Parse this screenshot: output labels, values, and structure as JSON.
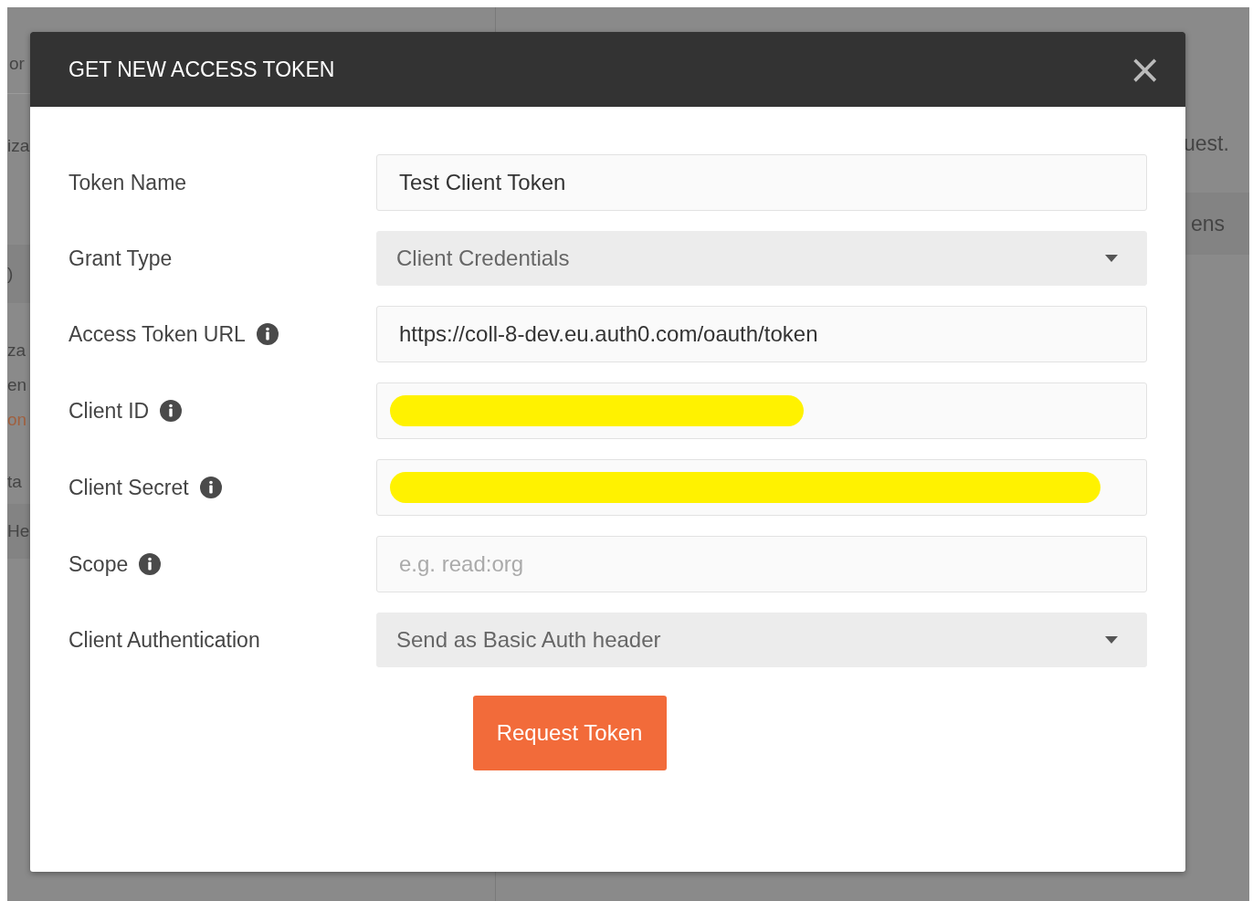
{
  "backdrop": {
    "left": [
      {
        "text": "or",
        "kind": "tab"
      },
      {
        "text": "iza",
        "kind": "line"
      },
      {
        "text": ")",
        "kind": "band"
      },
      {
        "text": "za",
        "kind": "line"
      },
      {
        "text": "en",
        "kind": "line"
      },
      {
        "text": "on",
        "kind": "link"
      },
      {
        "text": "ta",
        "kind": "line"
      },
      {
        "text": "He",
        "kind": "band"
      }
    ],
    "right": [
      {
        "text": "uest.",
        "kind": "line"
      },
      {
        "text": "ens",
        "kind": "band"
      }
    ]
  },
  "dialog": {
    "title": "GET NEW ACCESS TOKEN",
    "close": "×",
    "fields": [
      {
        "label": "Token Name",
        "info": false,
        "kind": "text",
        "value": "Test Client Token"
      },
      {
        "label": "Grant Type",
        "info": false,
        "kind": "select",
        "value": "Client Credentials"
      },
      {
        "label": "Access Token URL",
        "info": true,
        "kind": "text",
        "value": "https://coll-8-dev.eu.auth0.com/oauth/token"
      },
      {
        "label": "Client ID",
        "info": true,
        "kind": "redacted"
      },
      {
        "label": "Client Secret",
        "info": true,
        "kind": "redacted"
      },
      {
        "label": "Scope",
        "info": true,
        "kind": "text",
        "placeholder": "e.g. read:org"
      },
      {
        "label": "Client Authentication",
        "info": false,
        "kind": "select",
        "value": "Send as Basic Auth header"
      }
    ],
    "button": "Request Token"
  }
}
